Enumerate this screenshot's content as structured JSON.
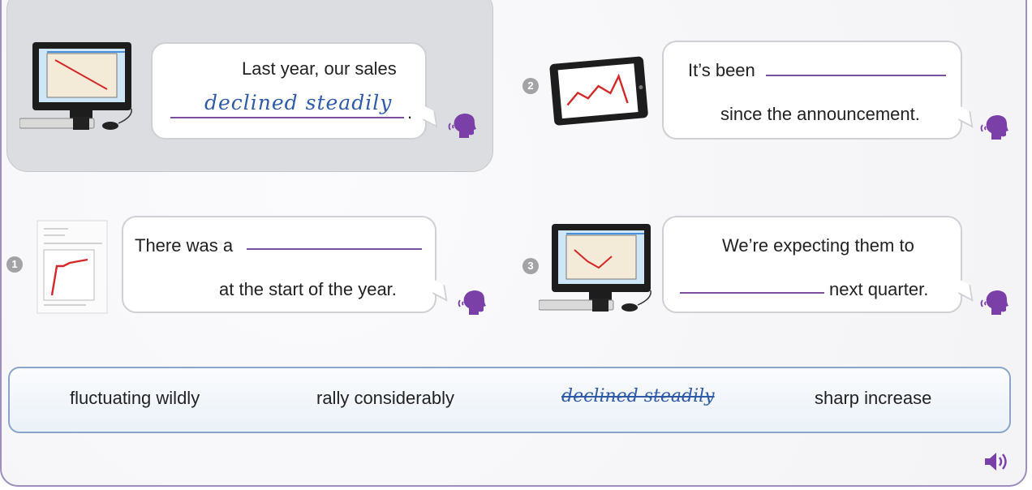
{
  "example": {
    "line1": "Last year, our sales",
    "answer": "declined steadily",
    "period": "."
  },
  "items": [
    {
      "number": "1",
      "before": "There was a",
      "after": "at the start of the year."
    },
    {
      "number": "2",
      "before": "It’s been",
      "after": "since the announcement."
    },
    {
      "number": "3",
      "before": "We’re expecting them to",
      "after": "next quarter."
    }
  ],
  "word_bank": [
    {
      "text": "fluctuating wildly",
      "used": false
    },
    {
      "text": "rally considerably",
      "used": false
    },
    {
      "text": "declined steadily",
      "used": true
    },
    {
      "text": "sharp increase",
      "used": false
    }
  ],
  "icons": {
    "speaker": "speaking-head-icon",
    "audio": "audio-volume-icon"
  },
  "colors": {
    "blank_line": "#7b4fa0",
    "speaker": "#7b3fa8",
    "answer": "#2f5aa8",
    "word_bank_border": "#8aa5c8"
  }
}
